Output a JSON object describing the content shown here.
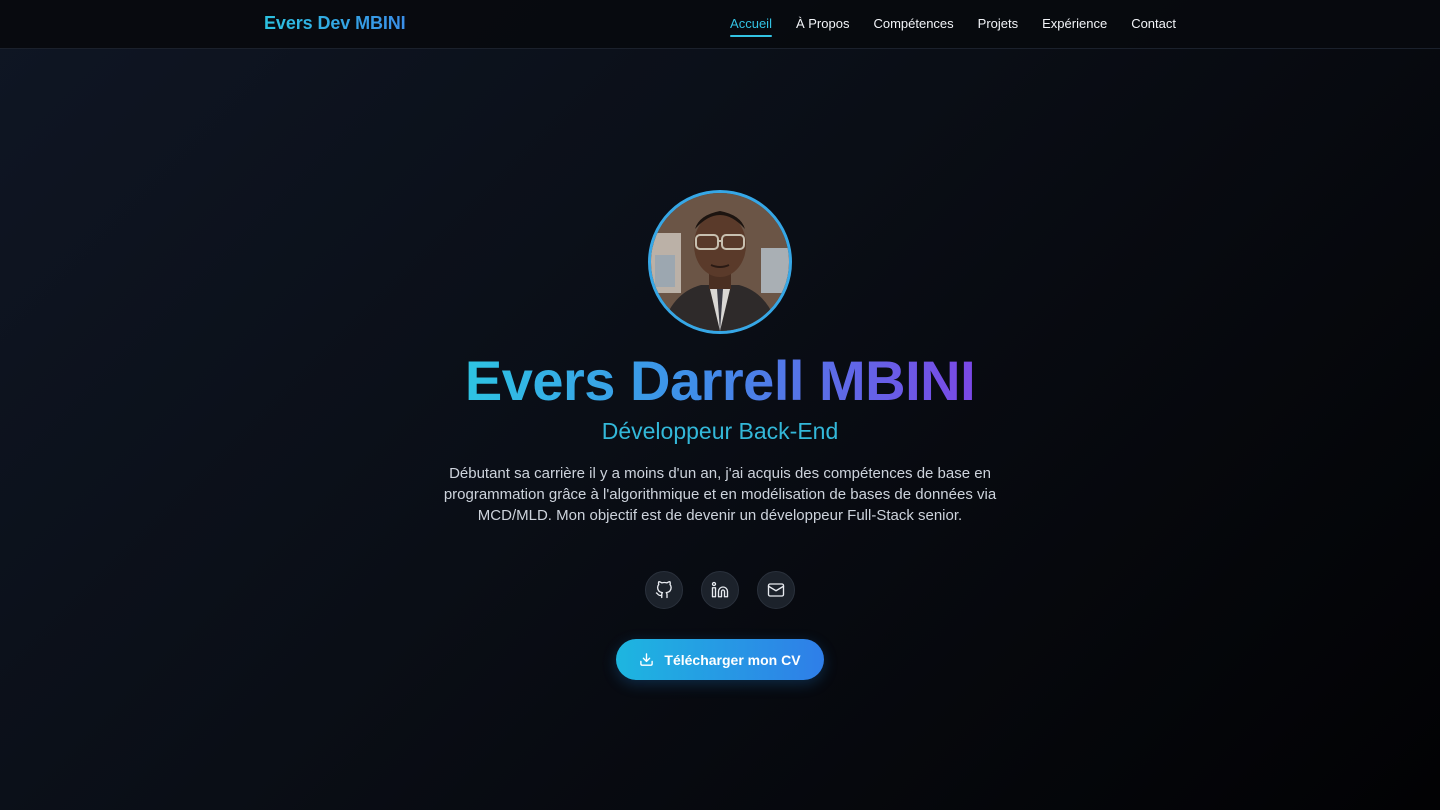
{
  "nav": {
    "brand": "Evers Dev MBINI",
    "links": [
      {
        "label": "Accueil",
        "active": true
      },
      {
        "label": "À Propos"
      },
      {
        "label": "Compétences"
      },
      {
        "label": "Projets"
      },
      {
        "label": "Expérience"
      },
      {
        "label": "Contact"
      }
    ]
  },
  "hero": {
    "name": "Evers Darrell MBINI",
    "role": "Développeur Back-End",
    "description": "Débutant sa carrière il y a moins d'un an, j'ai acquis des compétences de base en programmation grâce à l'algorithmique et en modélisation de bases de données via MCD/MLD. Mon objectif est de devenir un développeur Full-Stack senior.",
    "socials": [
      {
        "icon": "github-icon"
      },
      {
        "icon": "linkedin-icon"
      },
      {
        "icon": "mail-icon"
      }
    ],
    "cv_button": "Télécharger mon CV"
  },
  "colors": {
    "accent": "#33c3e3",
    "gradient_start": "#2ec4e3",
    "gradient_mid": "#3f8ee9",
    "gradient_end": "#7b48e6",
    "background": "#0a0e16"
  }
}
